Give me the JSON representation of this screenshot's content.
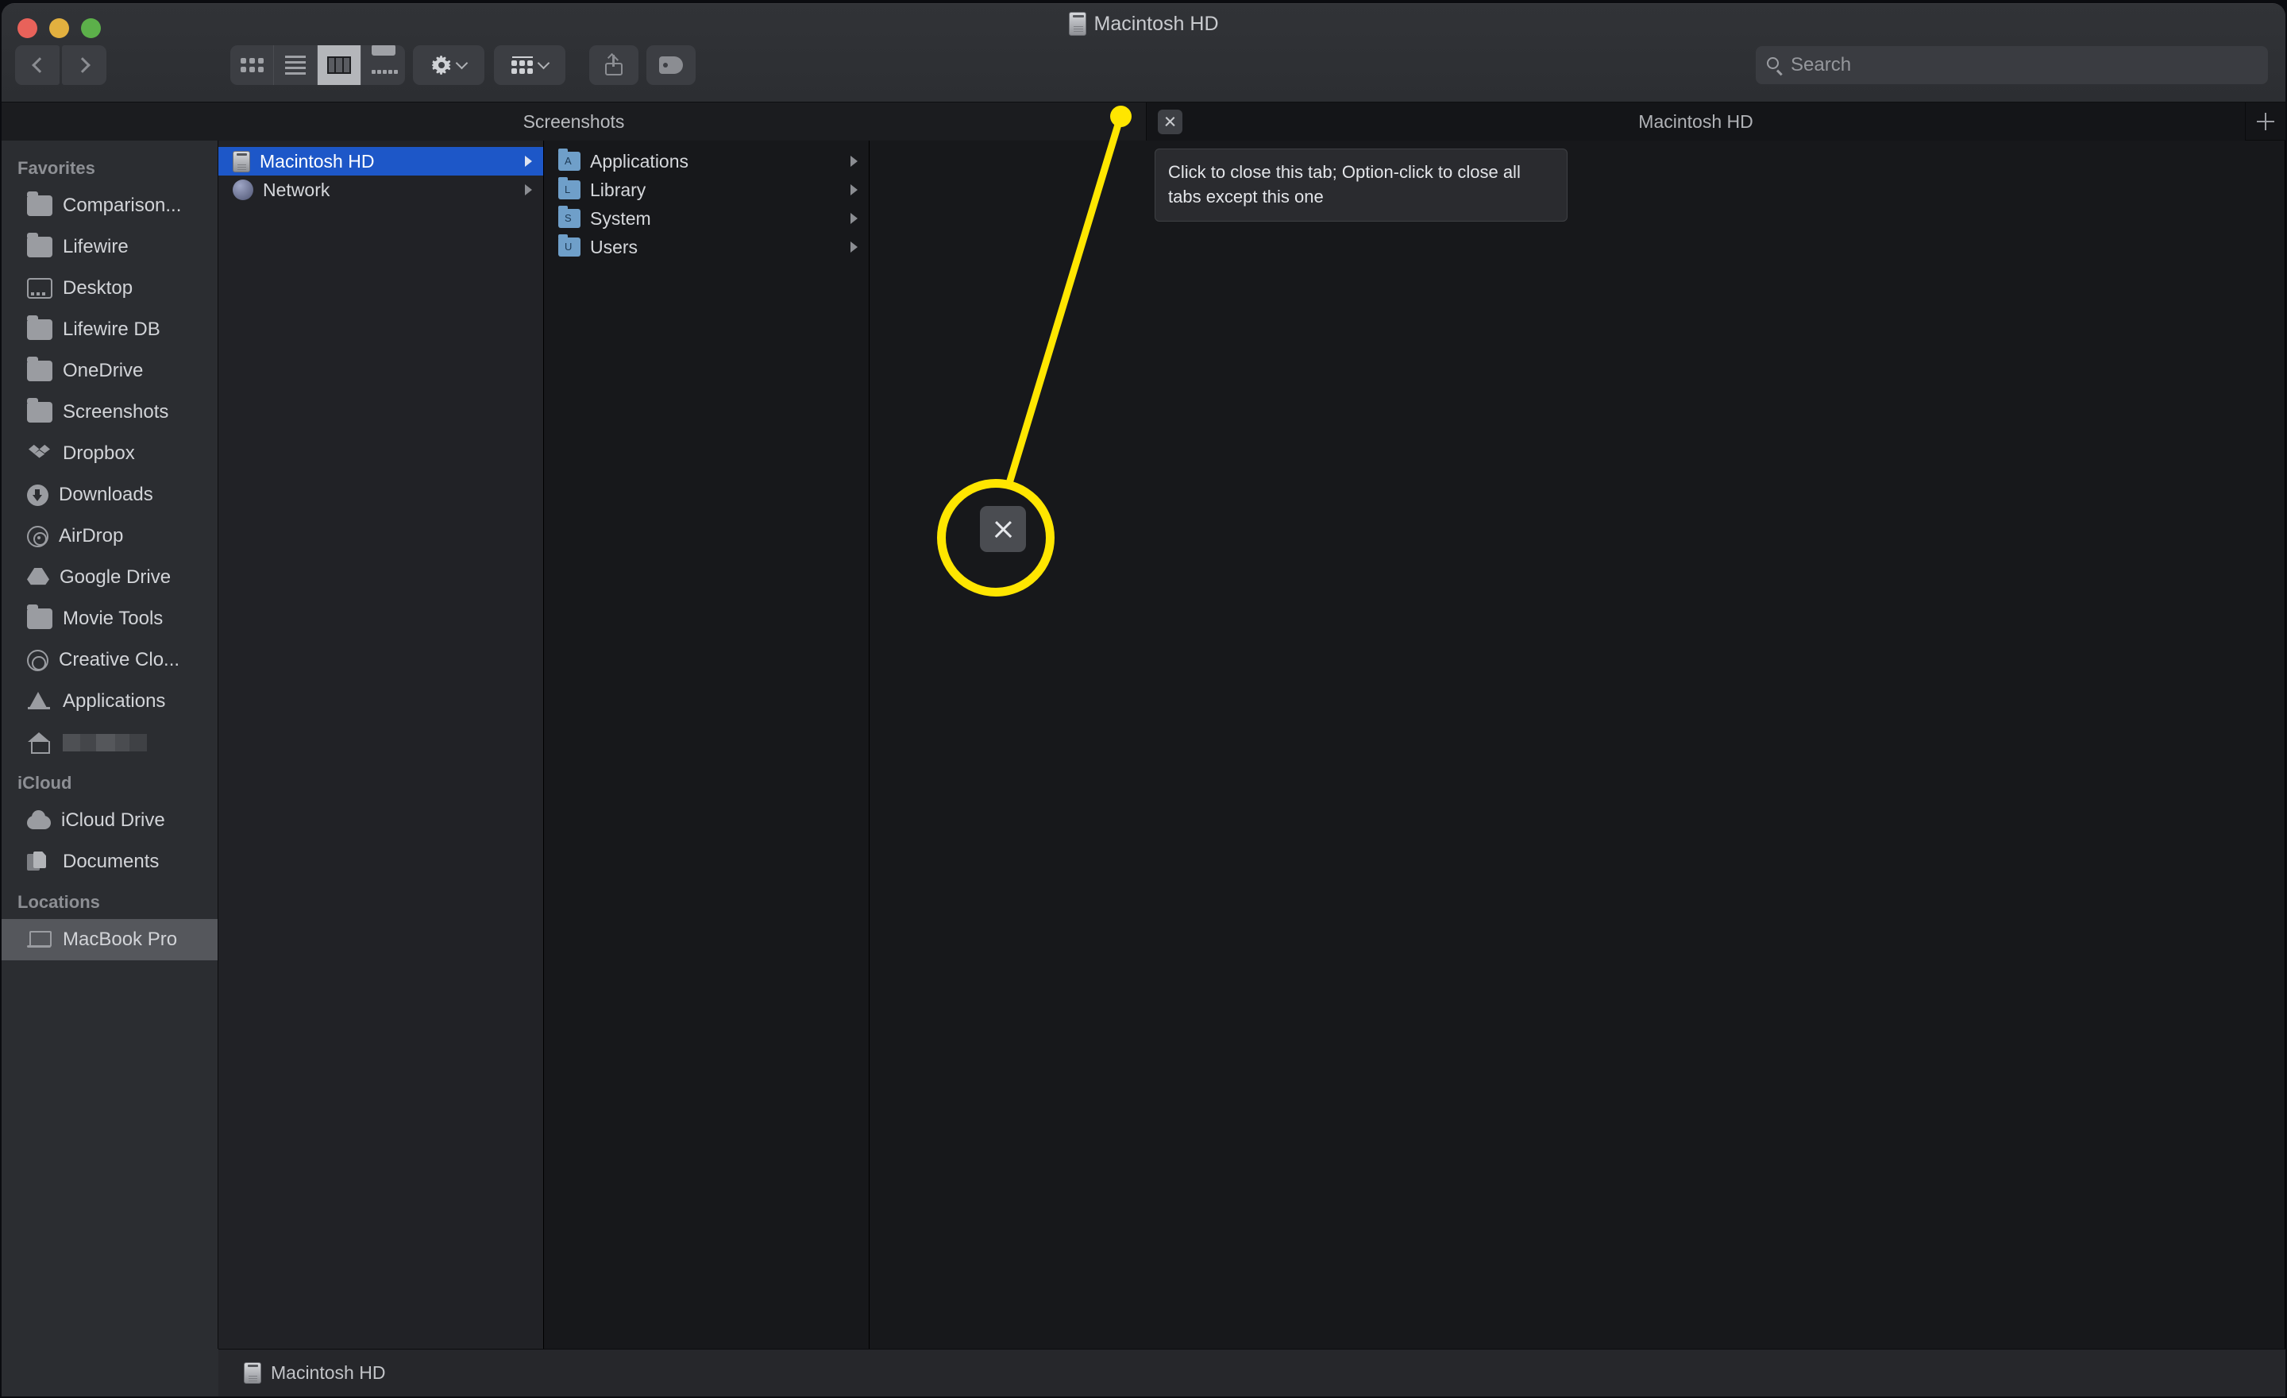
{
  "window": {
    "title": "Macintosh HD",
    "title_icon": "hard-drive-icon"
  },
  "traffic_lights": {
    "close": "close-window",
    "minimize": "minimize-window",
    "zoom": "zoom-window",
    "close_color": "#e8625a",
    "minimize_color": "#e2b03f",
    "zoom_color": "#5cb04a"
  },
  "toolbar": {
    "back_label": "Back",
    "forward_label": "Forward",
    "view_modes": [
      {
        "name": "icon-view",
        "label": "Icon View",
        "active": false
      },
      {
        "name": "list-view",
        "label": "List View",
        "active": false
      },
      {
        "name": "column-view",
        "label": "Column View",
        "active": true
      },
      {
        "name": "gallery-view",
        "label": "Gallery View",
        "active": false
      }
    ],
    "action_menu_label": "Action",
    "arrange_menu_label": "Group Items",
    "share_label": "Share",
    "tag_label": "Edit Tags"
  },
  "search": {
    "placeholder": "Search",
    "value": ""
  },
  "tabs": {
    "items": [
      {
        "label": "Screenshots",
        "active": false
      },
      {
        "label": "Macintosh HD",
        "active": true
      }
    ],
    "close_label": "Close Tab",
    "new_tab_label": "New Tab"
  },
  "tooltip": {
    "text": "Click to close this tab; Option-click to close all tabs except this one"
  },
  "sidebar": {
    "sections": [
      {
        "header": "Favorites",
        "items": [
          {
            "label": "Comparison...",
            "icon": "folder-icon",
            "selected": false
          },
          {
            "label": "Lifewire",
            "icon": "folder-icon",
            "selected": false
          },
          {
            "label": "Desktop",
            "icon": "desktop-icon",
            "selected": false
          },
          {
            "label": "Lifewire DB",
            "icon": "folder-icon",
            "selected": false
          },
          {
            "label": "OneDrive",
            "icon": "folder-icon",
            "selected": false
          },
          {
            "label": "Screenshots",
            "icon": "folder-icon",
            "selected": false
          },
          {
            "label": "Dropbox",
            "icon": "dropbox-icon",
            "selected": false
          },
          {
            "label": "Downloads",
            "icon": "downloads-icon",
            "selected": false
          },
          {
            "label": "AirDrop",
            "icon": "airdrop-icon",
            "selected": false
          },
          {
            "label": "Google Drive",
            "icon": "google-drive-icon",
            "selected": false
          },
          {
            "label": "Movie Tools",
            "icon": "folder-icon",
            "selected": false
          },
          {
            "label": "Creative Clo...",
            "icon": "creative-cloud-icon",
            "selected": false
          },
          {
            "label": "Applications",
            "icon": "app-store-icon",
            "selected": false
          },
          {
            "label": "",
            "icon": "home-icon",
            "selected": false,
            "redacted": true
          }
        ]
      },
      {
        "header": "iCloud",
        "items": [
          {
            "label": "iCloud Drive",
            "icon": "icloud-icon",
            "selected": false
          },
          {
            "label": "Documents",
            "icon": "documents-icon",
            "selected": false
          }
        ]
      },
      {
        "header": "Locations",
        "items": [
          {
            "label": "MacBook Pro",
            "icon": "laptop-icon",
            "selected": true
          }
        ]
      }
    ]
  },
  "columns": [
    {
      "name": "column-devices",
      "rows": [
        {
          "label": "Macintosh HD",
          "icon": "hard-drive-icon",
          "selected": true,
          "has_children": true
        },
        {
          "label": "Network",
          "icon": "network-globe-icon",
          "selected": false,
          "has_children": true
        }
      ]
    },
    {
      "name": "column-macintosh-hd",
      "rows": [
        {
          "label": "Applications",
          "icon": "blue-folder-icon",
          "selected": false,
          "has_children": true
        },
        {
          "label": "Library",
          "icon": "blue-folder-icon",
          "selected": false,
          "has_children": true
        },
        {
          "label": "System",
          "icon": "blue-folder-icon",
          "selected": false,
          "has_children": true
        },
        {
          "label": "Users",
          "icon": "blue-folder-icon",
          "selected": false,
          "has_children": true
        }
      ]
    }
  ],
  "path_bar": {
    "label": "Macintosh HD",
    "icon": "hard-drive-icon"
  },
  "annotation": {
    "color": "#ffe600",
    "callout_icon": "close-tab-x-icon",
    "description": "Yellow highlight circle pointing at the tab close button"
  },
  "colors": {
    "selection_blue": "#1d57c8",
    "window_bg": "#1c1d20",
    "sidebar_bg": "#2b2d31",
    "column_bg": "#17181b",
    "toolbar_bg": "#2f3135"
  }
}
